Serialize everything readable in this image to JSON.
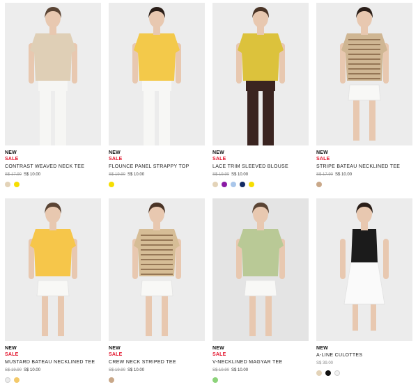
{
  "products": [
    {
      "badge_new": "NEW",
      "badge_sale": "SALE",
      "name": "CONTRAST WEAVED NECK TEE",
      "old_price": "S$ 17.90",
      "price": "S$ 10.00",
      "swatches": [
        "#e3d3b8",
        "#f6de00"
      ],
      "look": {
        "bg": "#ededed",
        "top": "#dfcfb6",
        "bottom": "#f6f6f4",
        "hair": "#5a4434"
      }
    },
    {
      "badge_new": "NEW",
      "badge_sale": "SALE",
      "name": "FLOUNCE PANEL STRAPPY TOP",
      "old_price": "S$ 19.90",
      "price": "S$ 10.00",
      "swatches": [
        "#f6de00"
      ],
      "look": {
        "bg": "#ececec",
        "top": "#f3c94a",
        "bottom": "#f7f7f5",
        "hair": "#2a1e18"
      }
    },
    {
      "badge_new": "NEW",
      "badge_sale": "SALE",
      "name": "LACE TRIM SLEEVED BLOUSE",
      "old_price": "S$ 19.90",
      "price": "S$ 10.00",
      "swatches": [
        "#e3d3b8",
        "#8a1aa5",
        "#a9c6ea",
        "#122a63",
        "#f6de00"
      ],
      "look": {
        "bg": "#ececec",
        "top": "#dcc23c",
        "bottom": "#3a2420",
        "hair": "#4a3426"
      }
    },
    {
      "badge_new": "NEW",
      "badge_sale": "SALE",
      "name": "STRIPE BATEAU NECKLINED TEE",
      "old_price": "S$ 17.90",
      "price": "S$ 10.00",
      "swatches": [
        "#c9a889"
      ],
      "look": {
        "bg": "#ececec",
        "top": "#cfb693",
        "bottom": "#f8f8f6",
        "hair": "#2a1e18"
      }
    },
    {
      "badge_new": "NEW",
      "badge_sale": "SALE",
      "name": "MUSTARD BATEAU NECKLINED TEE",
      "old_price": "S$ 19.90",
      "price": "S$ 10.00",
      "swatches": [
        "#ececec",
        "#f3c96a"
      ],
      "look": {
        "bg": "#ececec",
        "top": "#f6c64a",
        "bottom": "#f8f8f6",
        "hair": "#5a4434"
      }
    },
    {
      "badge_new": "NEW",
      "badge_sale": "SALE",
      "name": "CREW NECK STRIPED TEE",
      "old_price": "S$ 19.90",
      "price": "S$ 10.00",
      "swatches": [
        "#c9a889"
      ],
      "look": {
        "bg": "#ececec",
        "top": "#d6bd96",
        "bottom": "#f8f8f6",
        "hair": "#4a3426"
      }
    },
    {
      "badge_new": "NEW",
      "badge_sale": "SALE",
      "name": "V-NECKLINED MAGYAR TEE",
      "old_price": "S$ 19.90",
      "price": "S$ 10.00",
      "swatches": [
        "#8cd37a"
      ],
      "look": {
        "bg": "#e4e4e4",
        "top": "#b9c996",
        "bottom": "#f8f8f6",
        "hair": "#5a4434"
      }
    },
    {
      "badge_new": "NEW",
      "badge_sale": "",
      "name": "A-LINE CULOTTES",
      "old_price": "",
      "price": "S$ 39.00",
      "swatches": [
        "#e3d3b8",
        "#111111",
        "#f2f2f2"
      ],
      "look": {
        "bg": "#ececec",
        "top": "#1b1b1b",
        "bottom": "#fafafa",
        "hair": "#2a1e18"
      }
    }
  ]
}
